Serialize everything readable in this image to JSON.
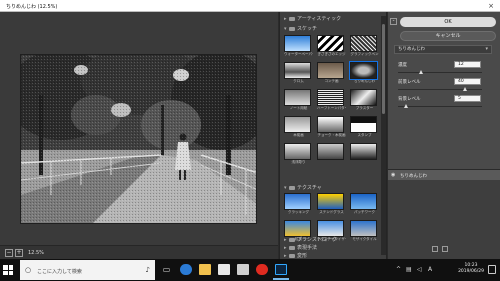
{
  "window": {
    "title": "ちりめんじわ (12.5%)",
    "close_glyph": "×"
  },
  "preview": {
    "zoom_label": "12.5%",
    "zoom_out_glyph": "−",
    "zoom_in_glyph": "+"
  },
  "gallery": {
    "folders": [
      {
        "label": "アーティスティック",
        "expanded": false
      },
      {
        "label": "スケッチ",
        "expanded": true
      },
      {
        "label": "テクスチャ",
        "expanded": true
      },
      {
        "label": "ブラシストローク",
        "expanded": false
      },
      {
        "label": "表現手法",
        "expanded": false
      },
      {
        "label": "変形",
        "expanded": false
      }
    ],
    "sketch_thumbs": [
      "ウォーターペーパー",
      "ぎざぎざのエッジ",
      "グラフィックペン",
      "クロム",
      "コンテ画",
      "ちりめんじわ",
      "ノート用紙",
      "ハーフトーンパターン",
      "プラスター",
      "木炭画",
      "チョーク・木炭画",
      "スタンプ",
      "浅浮彫り",
      "",
      ""
    ],
    "texture_thumbs": [
      "クラッキング",
      "ステンドグラス",
      "パッチワーク",
      "粒状",
      "テクスチャライザー",
      "モザイクタイル"
    ],
    "selected_thumb": "ちりめんじわ"
  },
  "settings": {
    "ok_label": "OK",
    "cancel_label": "キャンセル",
    "filter_select": "ちりめんじわ",
    "params": [
      {
        "label": "濃度",
        "value": "12",
        "level": 0.28
      },
      {
        "label": "前景レベル",
        "value": "40",
        "level": 0.8
      },
      {
        "label": "背景レベル",
        "value": "5",
        "level": 0.1
      }
    ],
    "layer_name": "ちりめんじわ"
  },
  "taskbar": {
    "search_placeholder": "ここに入力して検索",
    "time": "10:23",
    "date": "2019/06/29",
    "ime_indicator": "A"
  },
  "colors": {
    "accent": "#1473e6",
    "panel": "#4a4a4a",
    "gallery_bg": "#3e3e3e"
  }
}
